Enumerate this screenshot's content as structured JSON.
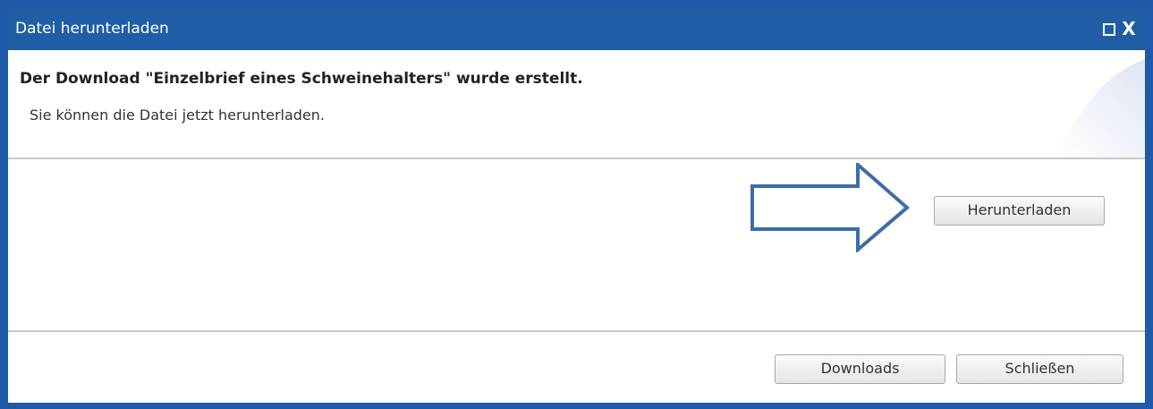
{
  "dialog": {
    "title": "Datei herunterladen",
    "maximize_icon": "maximize-icon",
    "close_label": "X"
  },
  "message": {
    "heading": "Der Download \"Einzelbrief eines Schweinehalters\" wurde erstellt.",
    "text": "Sie können die Datei jetzt herunterladen."
  },
  "actions": {
    "download_label": "Herunterladen"
  },
  "footer": {
    "downloads_label": "Downloads",
    "close_label": "Schließen"
  },
  "annotation": {
    "arrow_icon": "right-arrow-icon",
    "arrow_color": "#3b6ea8"
  },
  "colors": {
    "titlebar": "#1f5ea6",
    "border": "#1f5aa8"
  }
}
